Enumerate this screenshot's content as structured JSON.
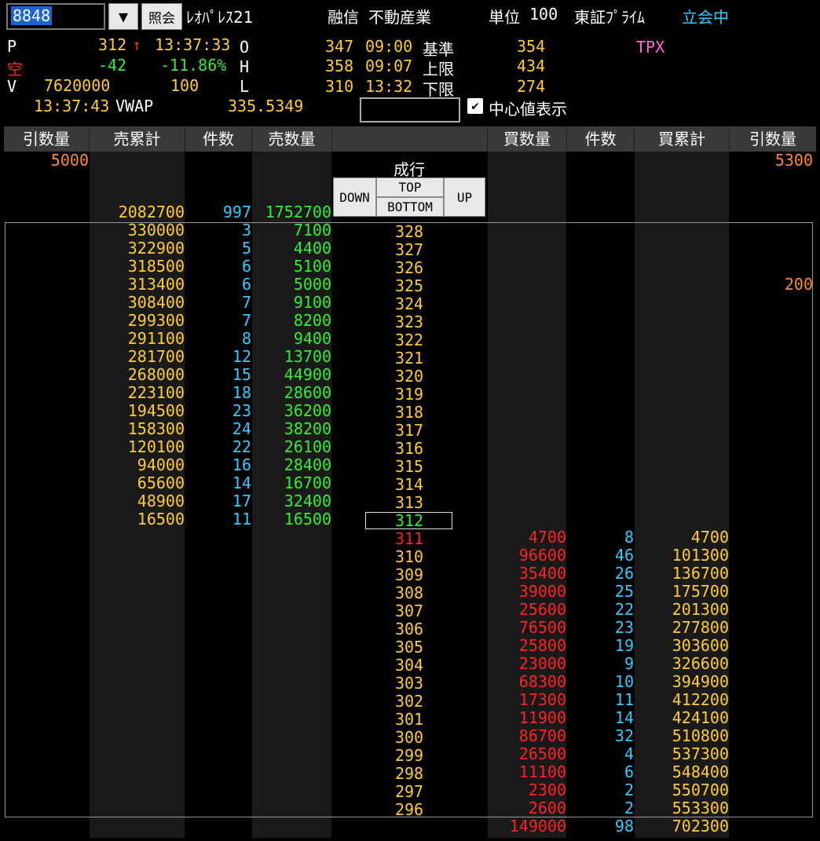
{
  "header": {
    "code": "8848",
    "dropdown_icon": "▼",
    "lookup_label": "照会",
    "name": "ﾚｵﾊﾟﾚｽ21",
    "margin": "融信",
    "sector": "不動産業",
    "unit_label": "単位",
    "unit": "100",
    "market": "東証ﾌﾟﾗｲﾑ",
    "status": "立会中"
  },
  "quote": {
    "p_label": "P",
    "price": "312",
    "arrow": "↑",
    "price_time": "13:37:33",
    "short_label": "空",
    "change": "-42",
    "change_pct": "-11.86%",
    "v_label": "V",
    "volume": "7620000",
    "lot": "100",
    "vwap_time": "13:37:43",
    "vwap_label": "VWAP",
    "vwap": "335.5349",
    "o_label": "O",
    "open": "347",
    "open_time": "09:00",
    "h_label": "H",
    "high": "358",
    "high_time": "09:07",
    "l_label": "L",
    "low": "310",
    "low_time": "13:32",
    "base_label": "基準",
    "base": "354",
    "upper_label": "上限",
    "upper": "434",
    "lower_label": "下限",
    "lower": "274",
    "tpx": "TPX",
    "center_check": "✔",
    "center_label": "中心値表示"
  },
  "columns": [
    "引数量",
    "売累計",
    "件数",
    "売数量",
    "",
    "買数量",
    "件数",
    "買累計",
    "引数量"
  ],
  "book": {
    "sell_close": "5000",
    "buy_close": "5300",
    "market_label": "成行",
    "nav": {
      "down": "DOWN",
      "top": "TOP",
      "bottom": "BOTTOM",
      "up": "UP"
    },
    "over_sell": {
      "cum": "2082700",
      "cnt": "997",
      "qty": "1752700"
    },
    "asks": [
      {
        "cum": "330000",
        "cnt": "3",
        "qty": "7100",
        "price": "328"
      },
      {
        "cum": "322900",
        "cnt": "5",
        "qty": "4400",
        "price": "327"
      },
      {
        "cum": "318500",
        "cnt": "6",
        "qty": "5100",
        "price": "326"
      },
      {
        "cum": "313400",
        "cnt": "6",
        "qty": "5000",
        "price": "325",
        "close": "200"
      },
      {
        "cum": "308400",
        "cnt": "7",
        "qty": "9100",
        "price": "324"
      },
      {
        "cum": "299300",
        "cnt": "7",
        "qty": "8200",
        "price": "323"
      },
      {
        "cum": "291100",
        "cnt": "8",
        "qty": "9400",
        "price": "322"
      },
      {
        "cum": "281700",
        "cnt": "12",
        "qty": "13700",
        "price": "321"
      },
      {
        "cum": "268000",
        "cnt": "15",
        "qty": "44900",
        "price": "320"
      },
      {
        "cum": "223100",
        "cnt": "18",
        "qty": "28600",
        "price": "319"
      },
      {
        "cum": "194500",
        "cnt": "23",
        "qty": "36200",
        "price": "318"
      },
      {
        "cum": "158300",
        "cnt": "24",
        "qty": "38200",
        "price": "317"
      },
      {
        "cum": "120100",
        "cnt": "22",
        "qty": "26100",
        "price": "316"
      },
      {
        "cum": "94000",
        "cnt": "16",
        "qty": "28400",
        "price": "315"
      },
      {
        "cum": "65600",
        "cnt": "14",
        "qty": "16700",
        "price": "314"
      },
      {
        "cum": "48900",
        "cnt": "17",
        "qty": "32400",
        "price": "313"
      },
      {
        "cum": "16500",
        "cnt": "11",
        "qty": "16500",
        "price": "312"
      }
    ],
    "bids": [
      {
        "price": "311",
        "qty": "4700",
        "cnt": "8",
        "cum": "4700"
      },
      {
        "price": "310",
        "qty": "96600",
        "cnt": "46",
        "cum": "101300"
      },
      {
        "price": "309",
        "qty": "35400",
        "cnt": "26",
        "cum": "136700"
      },
      {
        "price": "308",
        "qty": "39000",
        "cnt": "25",
        "cum": "175700"
      },
      {
        "price": "307",
        "qty": "25600",
        "cnt": "22",
        "cum": "201300"
      },
      {
        "price": "306",
        "qty": "76500",
        "cnt": "23",
        "cum": "277800"
      },
      {
        "price": "305",
        "qty": "25800",
        "cnt": "19",
        "cum": "303600"
      },
      {
        "price": "304",
        "qty": "23000",
        "cnt": "9",
        "cum": "326600"
      },
      {
        "price": "303",
        "qty": "68300",
        "cnt": "10",
        "cum": "394900"
      },
      {
        "price": "302",
        "qty": "17300",
        "cnt": "11",
        "cum": "412200"
      },
      {
        "price": "301",
        "qty": "11900",
        "cnt": "14",
        "cum": "424100"
      },
      {
        "price": "300",
        "qty": "86700",
        "cnt": "32",
        "cum": "510800"
      },
      {
        "price": "299",
        "qty": "26500",
        "cnt": "4",
        "cum": "537300"
      },
      {
        "price": "298",
        "qty": "11100",
        "cnt": "6",
        "cum": "548400"
      },
      {
        "price": "297",
        "qty": "2300",
        "cnt": "2",
        "cum": "550700"
      },
      {
        "price": "296",
        "qty": "2600",
        "cnt": "2",
        "cum": "553300"
      }
    ],
    "under_buy": {
      "qty": "149000",
      "cnt": "98",
      "cum": "702300"
    }
  }
}
